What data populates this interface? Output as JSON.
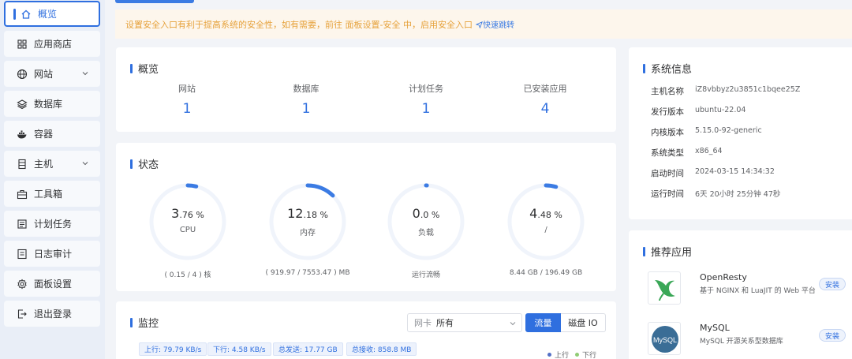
{
  "sidebar": {
    "items": [
      {
        "label": "概览",
        "icon": "home-icon",
        "active": true
      },
      {
        "label": "应用商店",
        "icon": "apps-icon"
      },
      {
        "label": "网站",
        "icon": "globe-icon",
        "expandable": true
      },
      {
        "label": "数据库",
        "icon": "layers-icon"
      },
      {
        "label": "容器",
        "icon": "docker-icon"
      },
      {
        "label": "主机",
        "icon": "server-icon",
        "expandable": true
      },
      {
        "label": "工具箱",
        "icon": "toolbox-icon"
      },
      {
        "label": "计划任务",
        "icon": "task-icon"
      },
      {
        "label": "日志审计",
        "icon": "log-icon"
      },
      {
        "label": "面板设置",
        "icon": "gear-icon"
      },
      {
        "label": "退出登录",
        "icon": "logout-icon"
      }
    ]
  },
  "notice": {
    "text": "设置安全入口有利于提高系统的安全性，如有需要，前往 面板设置-安全 中，启用安全入口",
    "link": "快速跳转"
  },
  "overview": {
    "title": "概览",
    "stats": [
      {
        "label": "网站",
        "value": "1"
      },
      {
        "label": "数据库",
        "value": "1"
      },
      {
        "label": "计划任务",
        "value": "1"
      },
      {
        "label": "已安装应用",
        "value": "4"
      }
    ]
  },
  "status": {
    "title": "状态",
    "gauges": [
      {
        "int": "3",
        "dec": ".76",
        "unit": "%",
        "label": "CPU",
        "foot": "( 0.15 / 4 ) 核",
        "percent": 3.76
      },
      {
        "int": "12",
        "dec": ".18",
        "unit": "%",
        "label": "内存",
        "foot": "( 919.97 / 7553.47 ) MB",
        "percent": 12.18
      },
      {
        "int": "0",
        "dec": ".0",
        "unit": "%",
        "label": "负载",
        "foot": "运行流畅",
        "percent": 0
      },
      {
        "int": "4",
        "dec": ".48",
        "unit": "%",
        "label": "/",
        "foot": "8.44 GB / 196.49 GB",
        "percent": 4.48
      }
    ]
  },
  "monitor": {
    "title": "监控",
    "select_prefix": "网卡",
    "select_value": "所有",
    "tab_traffic": "流量",
    "tab_disk": "磁盘 IO",
    "tags": [
      "上行: 79.79 KB/s",
      "下行: 4.58 KB/s",
      "总发送: 17.77 GB",
      "总接收: 858.8 MB"
    ],
    "legend_up": "上行",
    "legend_down": "下行",
    "color_up": "#5470c6",
    "color_down": "#91cc75"
  },
  "sysinfo": {
    "title": "系统信息",
    "rows": [
      {
        "key": "主机名称",
        "value": "iZ8vbbyz2u3851c1bqee25Z"
      },
      {
        "key": "发行版本",
        "value": "ubuntu-22.04"
      },
      {
        "key": "内核版本",
        "value": "5.15.0-92-generic"
      },
      {
        "key": "系统类型",
        "value": "x86_64"
      },
      {
        "key": "启动时间",
        "value": "2024-03-15 14:34:32"
      },
      {
        "key": "运行时间",
        "value": "6天 20小时 25分钟 47秒"
      }
    ]
  },
  "apps": {
    "title": "推荐应用",
    "items": [
      {
        "name": "OpenResty",
        "desc": "基于 NGINX 和 LuaJIT 的 Web 平台",
        "button": "安装"
      },
      {
        "name": "MySQL",
        "desc": "MySQL 开源关系型数据库",
        "button": "安装"
      }
    ]
  },
  "colors": {
    "accent": "#2f6fdf",
    "notice_text": "#e6a23c",
    "notice_bg": "#fdf6ec"
  }
}
